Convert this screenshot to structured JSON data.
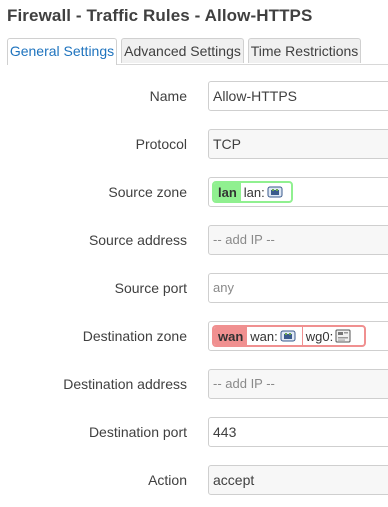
{
  "title": "Firewall - Traffic Rules - Allow-HTTPS",
  "tabs": [
    {
      "label": "General Settings"
    },
    {
      "label": "Advanced Settings"
    },
    {
      "label": "Time Restrictions"
    }
  ],
  "fields": {
    "name": {
      "label": "Name",
      "value": "Allow-HTTPS"
    },
    "protocol": {
      "label": "Protocol",
      "value": "TCP"
    },
    "source_zone": {
      "label": "Source zone",
      "zone": "lan",
      "networks": "lan:"
    },
    "source_address": {
      "label": "Source address",
      "placeholder": "-- add IP --"
    },
    "source_port": {
      "label": "Source port",
      "value": "any"
    },
    "destination_zone": {
      "label": "Destination zone",
      "zone": "wan",
      "networks_1": "wan:",
      "networks_2": "wg0:"
    },
    "destination_address": {
      "label": "Destination address",
      "placeholder": "-- add IP --"
    },
    "destination_port": {
      "label": "Destination port",
      "value": "443"
    },
    "action": {
      "label": "Action",
      "value": "accept"
    }
  },
  "colors": {
    "lan_zone": "#90f090",
    "wan_zone": "#f09090",
    "active_tab_text": "#1e73be"
  },
  "icons": {
    "lan_network": "ethernet-port-icon",
    "wan_network": "ethernet-port-icon",
    "wg0_network": "tunnel-interface-icon"
  }
}
